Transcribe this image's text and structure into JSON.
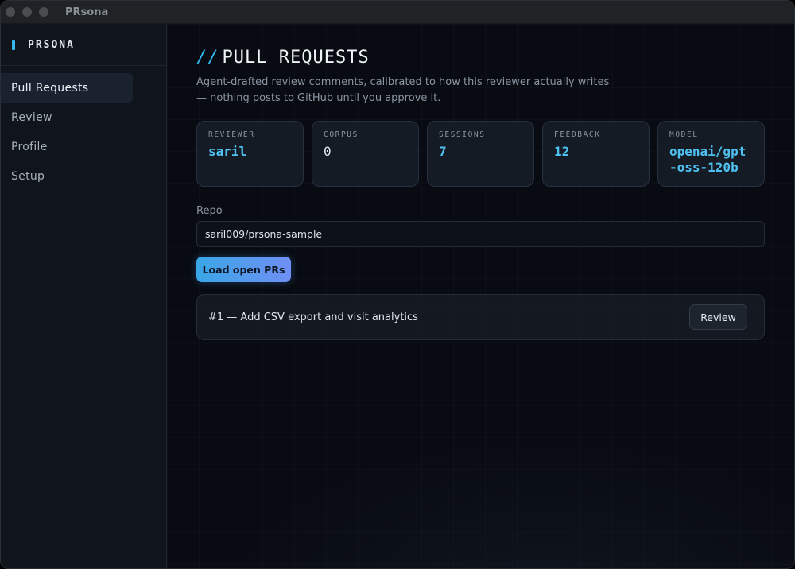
{
  "window": {
    "title": "PRsona"
  },
  "sidebar": {
    "brand": "PRSONA",
    "items": [
      {
        "label": "Pull Requests",
        "active": true
      },
      {
        "label": "Review",
        "active": false
      },
      {
        "label": "Profile",
        "active": false
      },
      {
        "label": "Setup",
        "active": false
      }
    ]
  },
  "main": {
    "heading_prefix": "//",
    "heading": "PULL REQUESTS",
    "subtitle": "Agent-drafted review comments, calibrated to how this reviewer actually writes — nothing posts to GitHub until you approve it.",
    "stats": [
      {
        "label": "REVIEWER",
        "value": "saril"
      },
      {
        "label": "CORPUS",
        "value": "0"
      },
      {
        "label": "SESSIONS",
        "value": "7"
      },
      {
        "label": "FEEDBACK",
        "value": "12"
      },
      {
        "label": "MODEL",
        "value": "openai/gpt-oss-120b"
      }
    ],
    "repo_label": "Repo",
    "repo_value": "saril009/prsona-sample",
    "load_button": "Load open PRs",
    "pull_requests": [
      {
        "title": "#1 — Add CSV export and visit analytics",
        "action": "Review"
      }
    ]
  },
  "colors": {
    "accent": "#35b7f0",
    "value": "#4ec1f2",
    "background": "#080b11"
  }
}
